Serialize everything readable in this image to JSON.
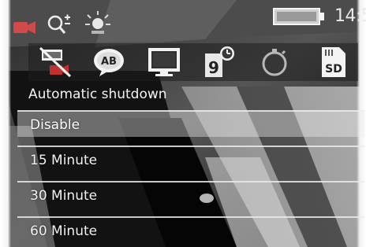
{
  "status": {
    "time": "14:5",
    "icons": [
      "video-camera-icon",
      "zoom-icon",
      "brightness-icon",
      "battery-icon"
    ]
  },
  "tabs": [
    {
      "name": "motion-detection-off-icon"
    },
    {
      "name": "ab-language-icon",
      "text": "AB"
    },
    {
      "name": "monitor-screen-icon"
    },
    {
      "name": "timer-clock-icon",
      "text": "9"
    },
    {
      "name": "stopwatch-icon"
    },
    {
      "name": "sd-card-icon",
      "text": "SD"
    }
  ],
  "menu": {
    "title": "Automatic shutdown",
    "options": [
      {
        "label": "Disable",
        "selected": true
      },
      {
        "label": "15 Minute",
        "selected": false
      },
      {
        "label": "30 Minute",
        "selected": false
      },
      {
        "label": "60 Minute",
        "selected": false
      }
    ]
  },
  "colors": {
    "text": "#f2f2f2",
    "icon_red": "#b02a2a",
    "selection": "#ebebeb"
  }
}
